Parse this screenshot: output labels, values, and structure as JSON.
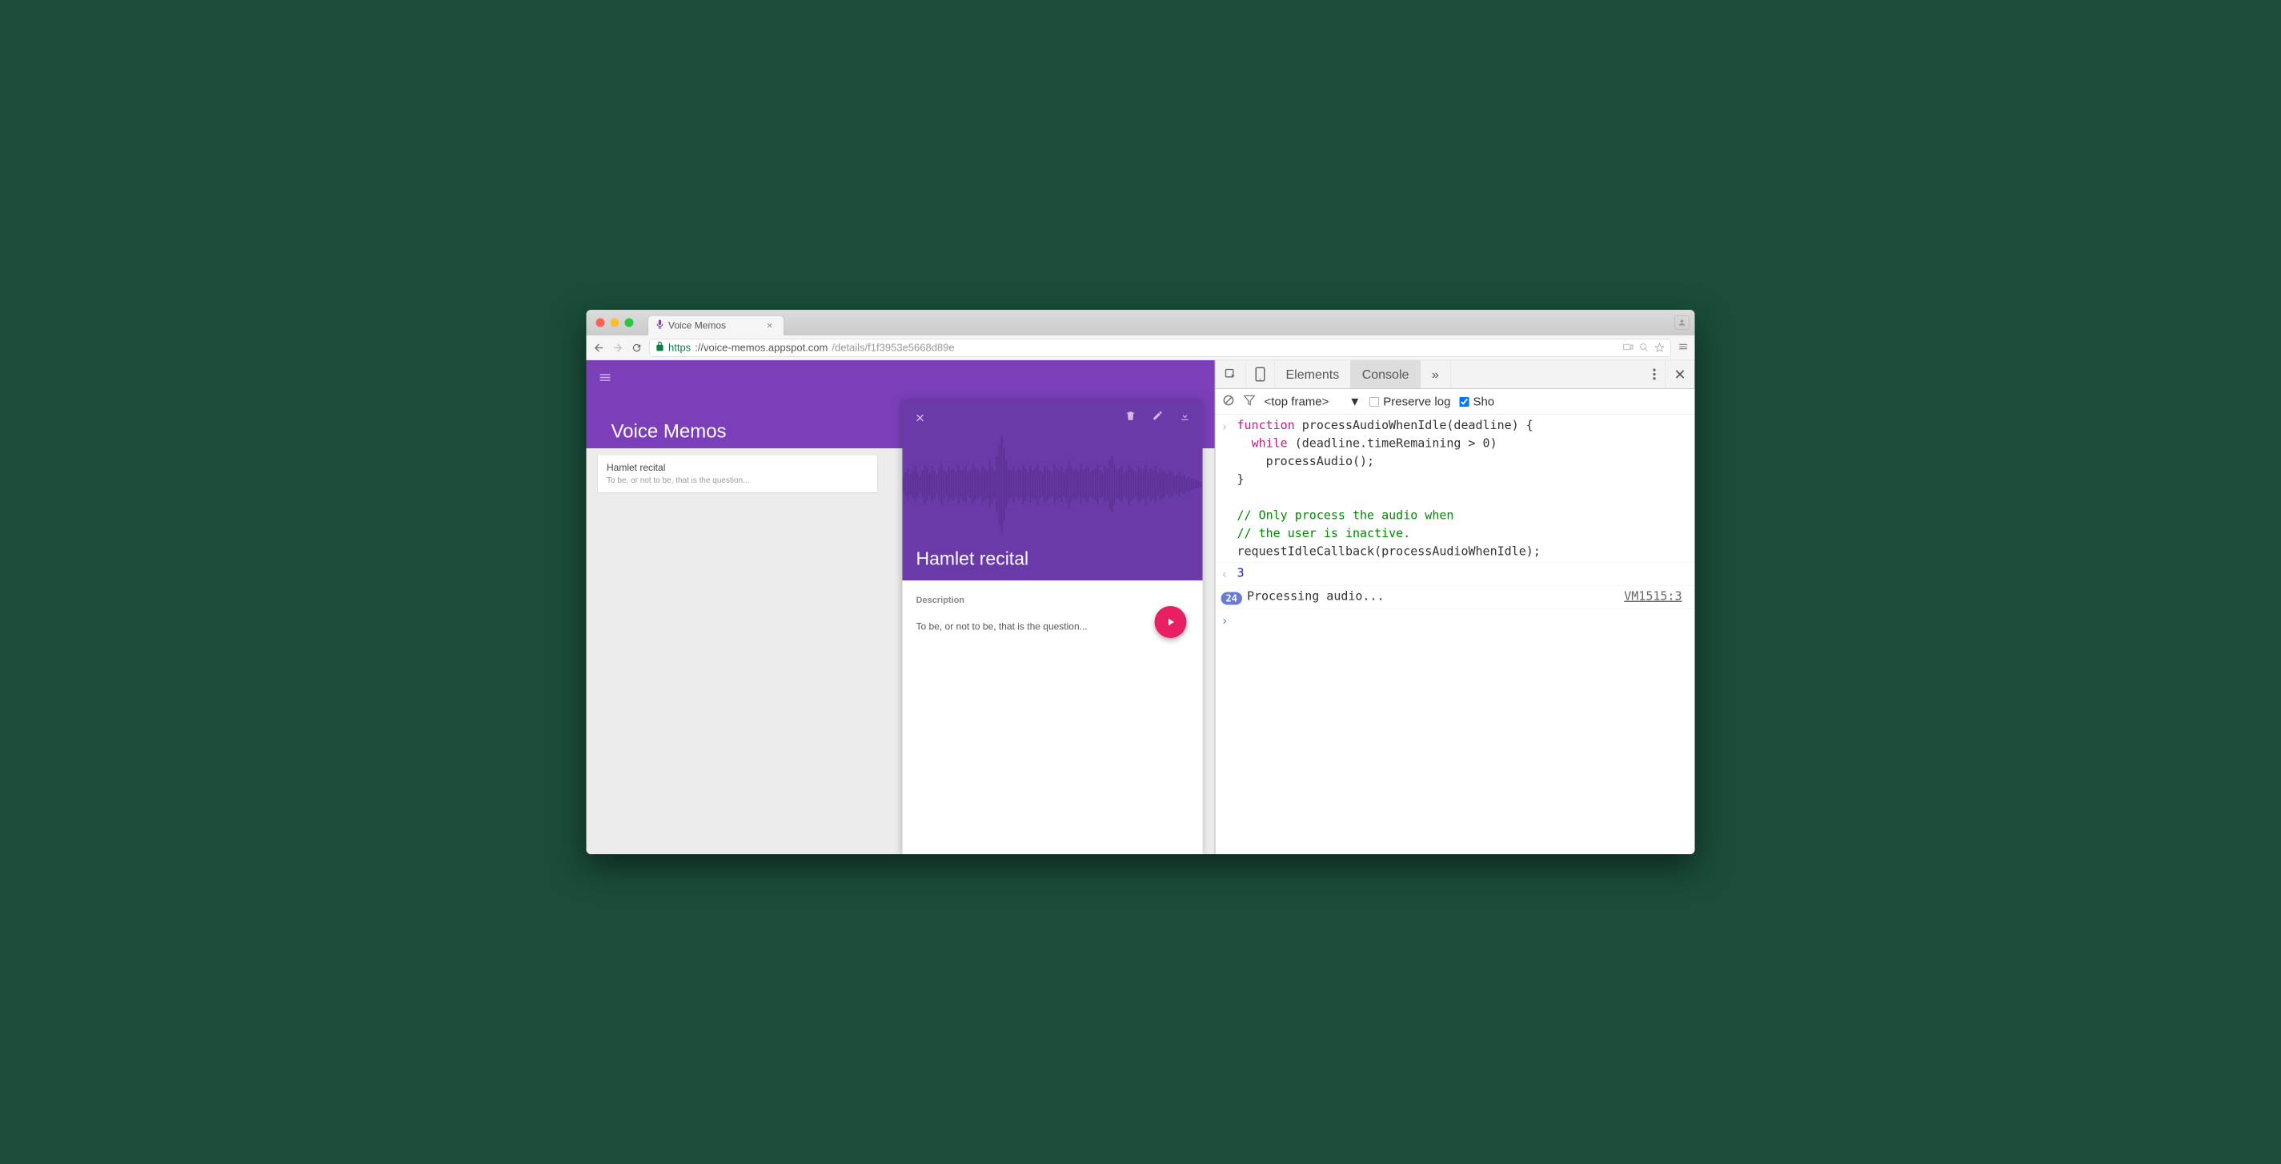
{
  "browser": {
    "tab_title": "Voice Memos",
    "url_protocol": "https",
    "url_host": "://voice-memos.appspot.com",
    "url_path": "/details/f1f3953e5668d89e"
  },
  "app": {
    "title": "Voice Memos",
    "list": [
      {
        "title": "Hamlet recital",
        "desc": "To be, or not to be, that is the question..."
      }
    ],
    "detail": {
      "title": "Hamlet recital",
      "desc_label": "Description",
      "desc_text": "To be, or not to be, that is the question..."
    }
  },
  "devtools": {
    "tabs": {
      "elements": "Elements",
      "console": "Console",
      "more": "»"
    },
    "toolbar": {
      "context": "<top frame>",
      "preserve_log": "Preserve log",
      "show": "Sho"
    },
    "console": {
      "code_line1_kw": "function",
      "code_line1_rest": " processAudioWhenIdle(deadline) {",
      "code_line2_kw": "while",
      "code_line2_rest": " (deadline.timeRemaining > 0)",
      "code_line3": "    processAudio();",
      "code_line4": "}",
      "code_line5": "",
      "code_line6_com": "// Only process the audio when",
      "code_line7_com": "// the user is inactive.",
      "code_line8": "requestIdleCallback(processAudioWhenIdle);",
      "result": "3",
      "log_count": "24",
      "log_msg": "Processing audio...",
      "log_src": "VM1515:3"
    }
  },
  "icons": {
    "mic": "🎤"
  }
}
